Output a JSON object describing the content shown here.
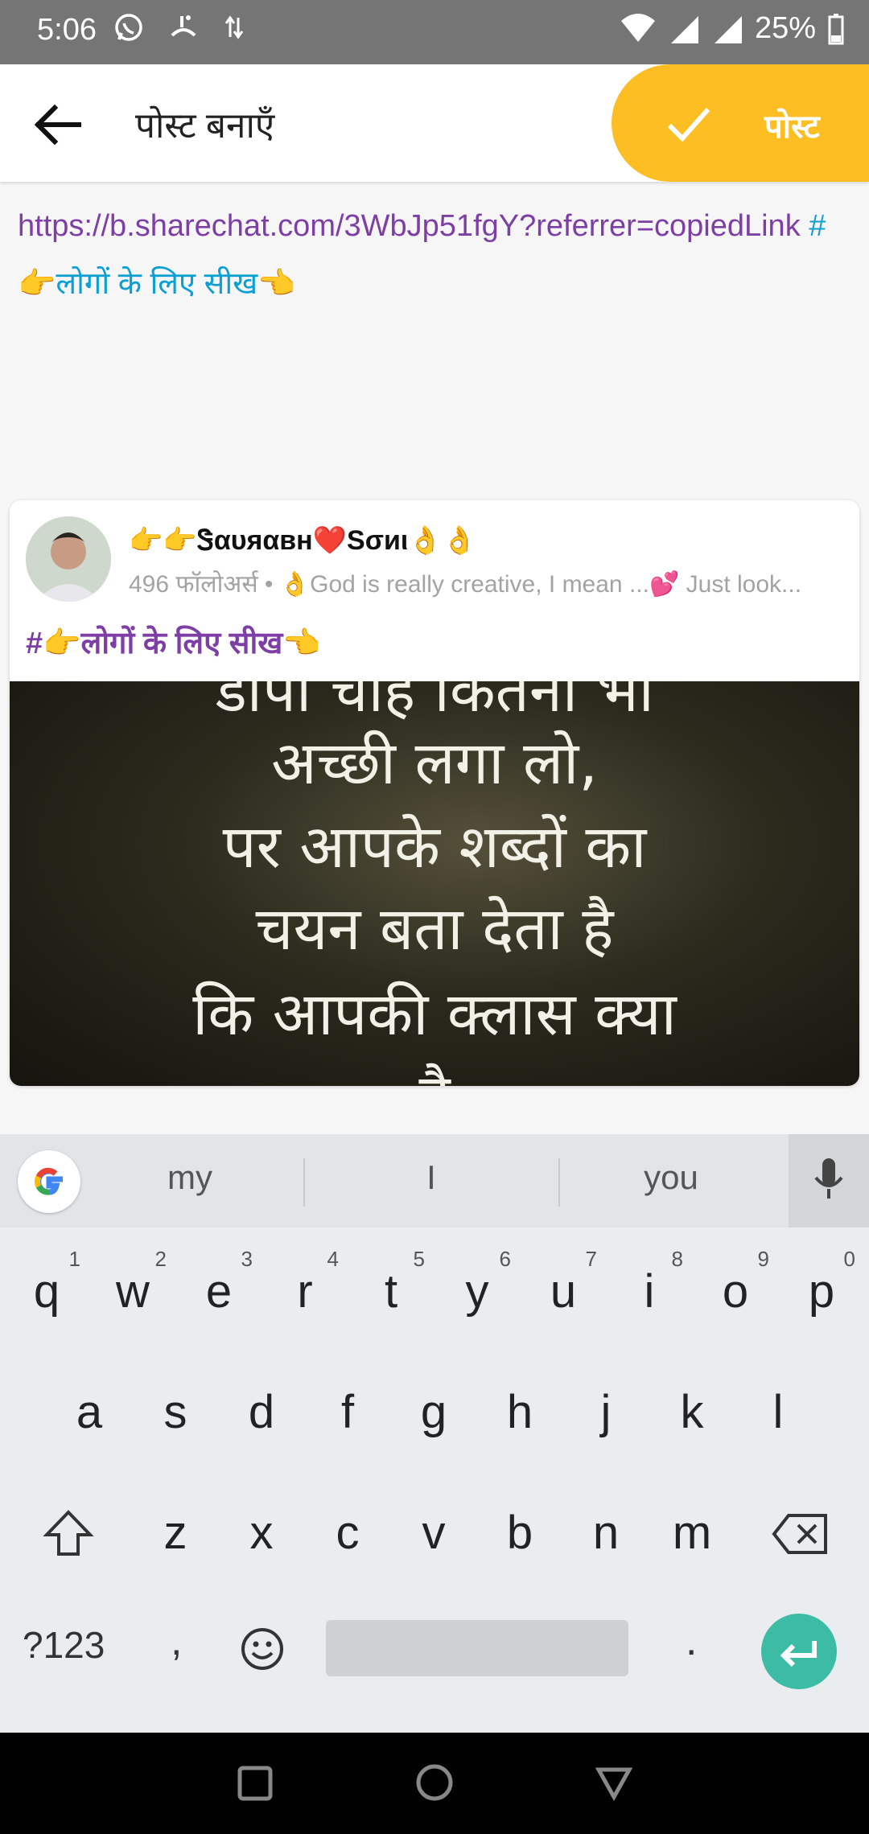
{
  "status_bar": {
    "time": "5:06",
    "battery": "25%"
  },
  "app_bar": {
    "title": "पोस्ट बनाएँ",
    "post_label": "पोस्ट"
  },
  "editor": {
    "link_text": "https://b.sharechat.com/3WbJp51fgY?referrer=copiedLink",
    "hashtag": "#👉लोगों के लिए सीख👈"
  },
  "card": {
    "author": "👉👉Ꮥαυяαвн❤️Sσиι👌👌",
    "meta": "496 फॉलोअर्स • 👌God is really creative,  I mean ...💕 Just look...",
    "hashtag": "#👉लोगों के लिए सीख👈",
    "image_lines": [
      "डोपी चाहे कितनी भी",
      "अच्छी लगा लो,",
      "पर आपके शब्दों का",
      "चयन बता देता है",
      "कि आपकी क्लास क्या",
      "है"
    ]
  },
  "keyboard": {
    "suggestions": [
      "my",
      "I",
      "you"
    ],
    "row1": [
      {
        "k": "q",
        "h": "1"
      },
      {
        "k": "w",
        "h": "2"
      },
      {
        "k": "e",
        "h": "3"
      },
      {
        "k": "r",
        "h": "4"
      },
      {
        "k": "t",
        "h": "5"
      },
      {
        "k": "y",
        "h": "6"
      },
      {
        "k": "u",
        "h": "7"
      },
      {
        "k": "i",
        "h": "8"
      },
      {
        "k": "o",
        "h": "9"
      },
      {
        "k": "p",
        "h": "0"
      }
    ],
    "row2": [
      "a",
      "s",
      "d",
      "f",
      "g",
      "h",
      "j",
      "k",
      "l"
    ],
    "row3": [
      "z",
      "x",
      "c",
      "v",
      "b",
      "n",
      "m"
    ],
    "symbols_label": "?123",
    "comma": ",",
    "period": "."
  },
  "colors": {
    "accent": "#fcbe22",
    "link": "#7d3fa6",
    "hashtag": "#0b9fd4",
    "enter": "#3dbca5"
  }
}
